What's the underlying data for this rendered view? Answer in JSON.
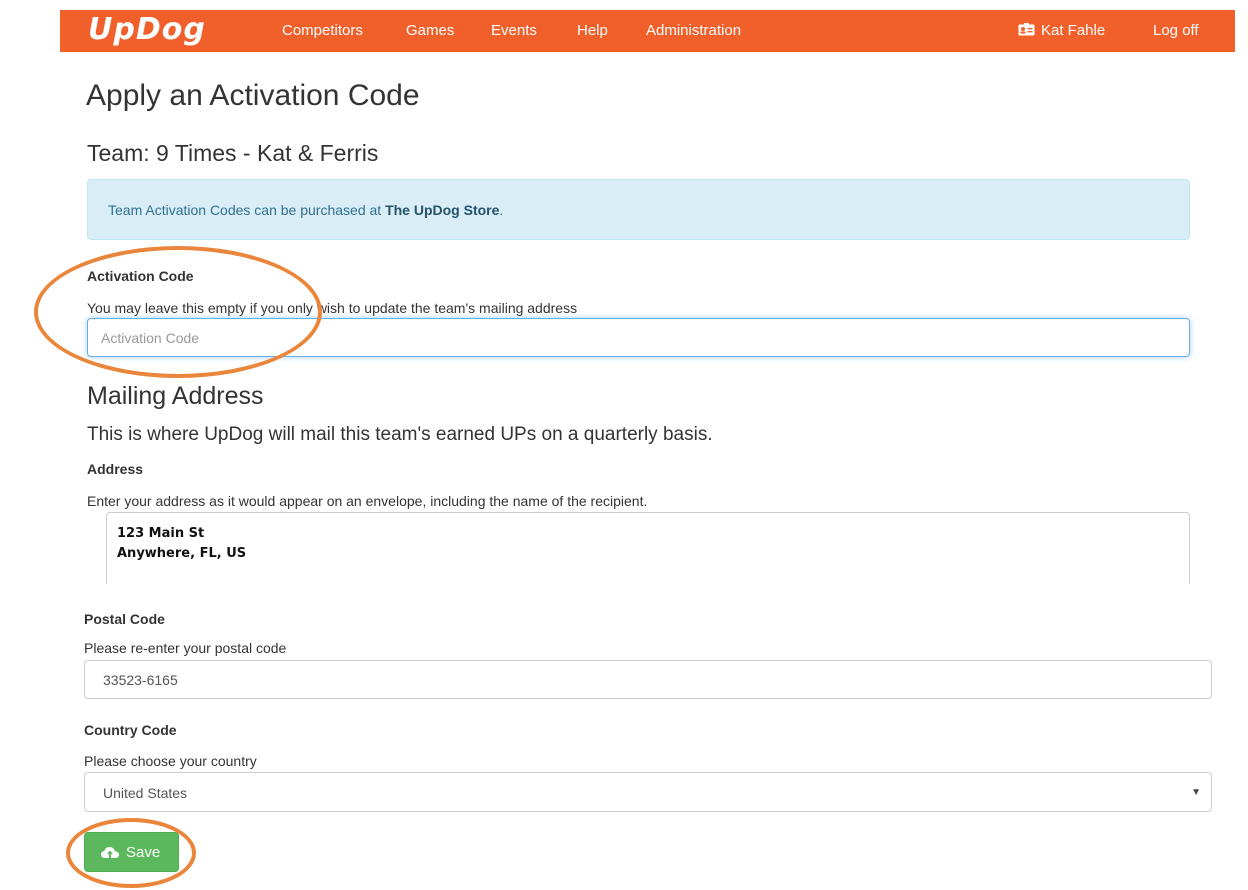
{
  "nav": {
    "brand": "UpDog",
    "links": [
      "Competitors",
      "Games",
      "Events",
      "Help",
      "Administration"
    ],
    "user_name": "Kat Fahle",
    "logoff": "Log off",
    "bar_color": "#f15f2a"
  },
  "page": {
    "title": "Apply an Activation Code",
    "team": "Team: 9 Times - Kat & Ferris"
  },
  "alert": {
    "text_before": "Team Activation Codes can be purchased at ",
    "link": "The UpDog Store",
    "text_after": "."
  },
  "activation": {
    "label": "Activation Code",
    "help": "You may leave this empty if you only wish to update the team's mailing address",
    "placeholder": "Activation Code",
    "value": ""
  },
  "mailing": {
    "heading": "Mailing Address",
    "lead": "This is where UpDog will mail this team's earned UPs on a quarterly basis.",
    "address_label": "Address",
    "address_help": "Enter your address as it would appear on an envelope, including the name of the recipient.",
    "address_lines": [
      "123 Main St",
      "Anywhere, FL, US"
    ]
  },
  "postal": {
    "label": "Postal Code",
    "help": "Please re-enter your postal code",
    "value": "33523-6165"
  },
  "country": {
    "label": "Country Code",
    "help": "Please choose your country",
    "selected": "United States"
  },
  "save": {
    "label": "Save",
    "icon": "cloud-upload-icon",
    "color": "#5cb85c"
  },
  "highlight_color": "#e9863b"
}
